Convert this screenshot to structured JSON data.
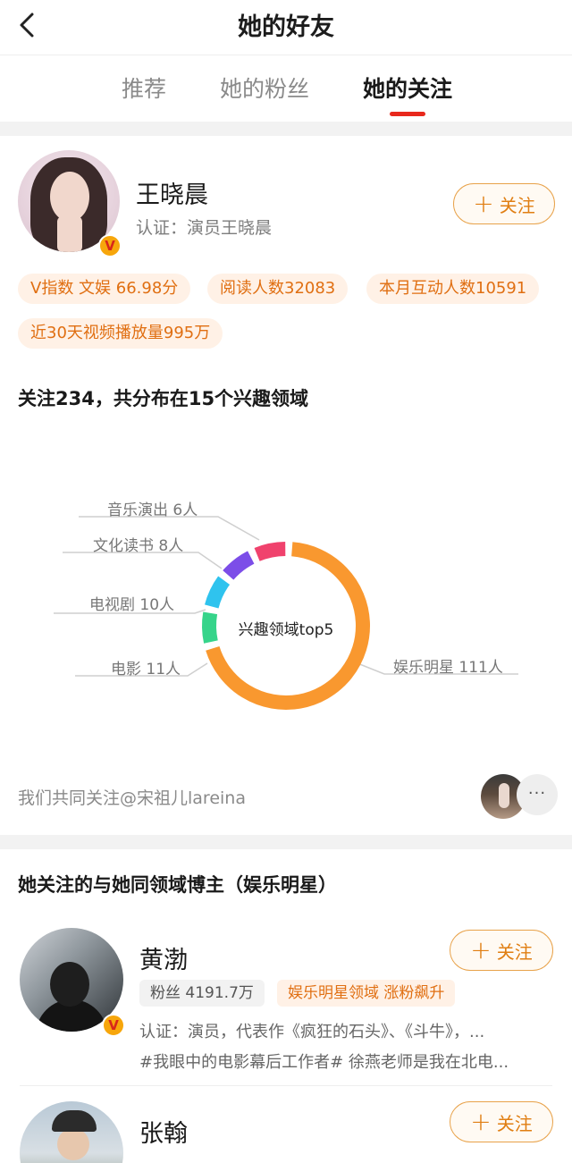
{
  "header": {
    "title": "她的好友"
  },
  "tabs": [
    {
      "label": "推荐",
      "active": false
    },
    {
      "label": "她的粉丝",
      "active": false
    },
    {
      "label": "她的关注",
      "active": true
    }
  ],
  "profile": {
    "name": "王晓晨",
    "certification": "认证：演员王晓晨",
    "follow_label": "关注",
    "tags": [
      "V指数 文娱 66.98分",
      "阅读人数32083",
      "本月互动人数10591",
      "近30天视频播放量995万"
    ]
  },
  "interests": {
    "title": "关注234，共分布在15个兴趣领域",
    "center_label": "兴趣领域top5"
  },
  "chart_data": {
    "type": "pie",
    "title": "兴趣领域top5",
    "categories": [
      "娱乐明星",
      "电影",
      "电视剧",
      "文化读书",
      "音乐演出"
    ],
    "values": [
      111,
      11,
      10,
      8,
      6
    ],
    "labels": [
      "娱乐明星 111人",
      "电影 11人",
      "电视剧 10人",
      "文化读书 8人",
      "音乐演出 6人"
    ],
    "colors": [
      "#f9982f",
      "#36d48a",
      "#2fc3ee",
      "#7c4de8",
      "#f0426d"
    ]
  },
  "mutual": {
    "text": "我们共同关注@宋祖儿lareina",
    "more": "···"
  },
  "same_field": {
    "title": "她关注的与她同领域博主（娱乐明星）",
    "bloggers": [
      {
        "name": "黄渤",
        "fans": "粉丝 4191.7万",
        "field_tag": "娱乐明星领域 涨粉飙升",
        "desc_line1": "认证：演员，代表作《疯狂的石头》、《斗牛》，...",
        "desc_line2": "#我眼中的电影幕后工作者# 徐燕老师是我在北电...",
        "follow_label": "关注"
      },
      {
        "name": "张翰",
        "follow_label": "关注"
      }
    ]
  },
  "colors": {
    "accent": "#e07e12",
    "tab_indicator": "#e8281c",
    "badge": "#f7a60b"
  }
}
